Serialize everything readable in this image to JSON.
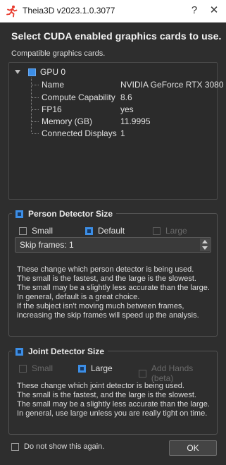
{
  "window": {
    "title": "Theia3D v2023.1.0.3077",
    "help_glyph": "?",
    "close_glyph": "✕",
    "app_icon": "theia-runner-icon",
    "accent_color": "#e8392c"
  },
  "heading": "Select CUDA enabled graphics cards to use.",
  "subheading": "Compatible graphics cards.",
  "gpu_tree": {
    "label": "GPU 0",
    "checked": true,
    "rows": [
      {
        "key": "Name",
        "value": "NVIDIA GeForce RTX 3080"
      },
      {
        "key": "Compute Capability",
        "value": "8.6"
      },
      {
        "key": "FP16",
        "value": "yes"
      },
      {
        "key": "Memory (GB)",
        "value": "11.9995"
      },
      {
        "key": "Connected Displays",
        "value": "1"
      }
    ]
  },
  "person_detector": {
    "title": "Person Detector Size",
    "options": [
      {
        "label": "Small",
        "checked": false,
        "enabled": true
      },
      {
        "label": "Default",
        "checked": true,
        "enabled": true
      },
      {
        "label": "Large",
        "checked": false,
        "enabled": false
      }
    ],
    "spinbox_text": "Skip frames: 1",
    "description": [
      "These change which person detector is being used.",
      "The small is the fastest, and the large is the slowest.",
      "The small may be a slightly less accurate than the large.",
      "In general, default is a great choice.",
      "If the subject isn't moving much between frames,",
      "increasing the skip frames will speed up the analysis."
    ]
  },
  "joint_detector": {
    "title": "Joint Detector Size",
    "options": [
      {
        "label": "Small",
        "checked": false,
        "enabled": false
      },
      {
        "label": "Large",
        "checked": true,
        "enabled": true
      },
      {
        "label": "Add Hands (beta)",
        "checked": false,
        "enabled": false
      }
    ],
    "description": [
      "These change which joint detector is being used.",
      "The small is the fastest, and the large is the slowest.",
      "The small may be a slightly less accurate than the large.",
      "In general, use large unless you are really tight on time."
    ]
  },
  "footer": {
    "dont_show_label": "Do not show this again.",
    "ok_label": "OK"
  }
}
